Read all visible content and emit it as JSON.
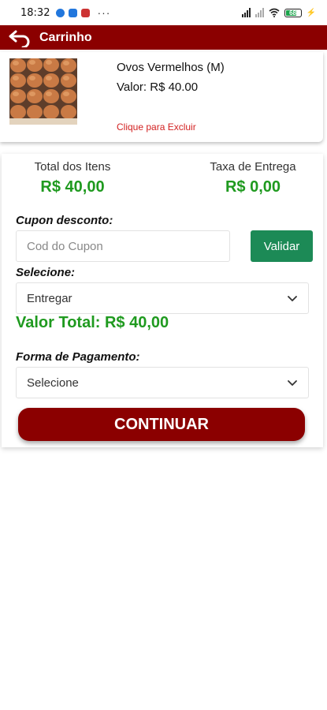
{
  "status_bar": {
    "time": "18:32",
    "more": "···",
    "battery": "68"
  },
  "app_bar": {
    "title": "Carrinho",
    "back_icon": "back-arrow-icon"
  },
  "cart_item": {
    "name": "Ovos Vermelhos (M)",
    "price": "Valor: R$ 40.00",
    "delete_label": "Clique para Excluir"
  },
  "summary": {
    "items_total_label": "Total dos Itens",
    "items_total_value": "R$ 40,00",
    "delivery_fee_label": "Taxa de Entrega",
    "delivery_fee_value": "R$ 0,00",
    "coupon_label": "Cupon desconto:",
    "coupon_placeholder": "Cod do Cupon",
    "coupon_value": "",
    "validate_label": "Validar",
    "delivery_select_label": "Selecione:",
    "delivery_selected": "Entregar",
    "grand_total": "Valor Total: R$ 40,00",
    "payment_label": "Forma de Pagamento:",
    "payment_selected": "Selecione",
    "continue_label": "CONTINUAR"
  },
  "colors": {
    "brand": "#8b0000",
    "accent_green": "#1f9a1f",
    "validate_green": "#1c8a56",
    "delete_red": "#d32222"
  }
}
